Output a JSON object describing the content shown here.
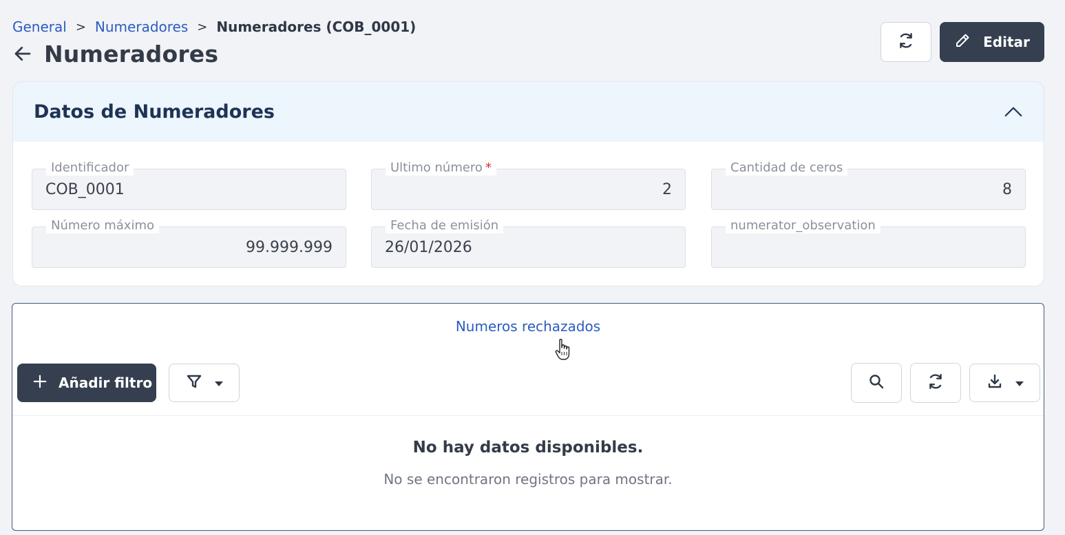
{
  "breadcrumb": {
    "items": [
      "General",
      "Numeradores"
    ],
    "separator": ">",
    "current": "Numeradores (COB_0001)"
  },
  "header": {
    "title": "Numeradores",
    "edit_label": "Editar"
  },
  "section": {
    "title": "Datos de Numeradores"
  },
  "fields": {
    "identificador": {
      "label": "Identificador",
      "value": "COB_0001"
    },
    "ultimo_numero": {
      "label": "Ultimo número",
      "required_mark": "*",
      "value": "2"
    },
    "cantidad_ceros": {
      "label": "Cantidad de ceros",
      "value": "8"
    },
    "numero_maximo": {
      "label": "Número máximo",
      "value": "99.999.999"
    },
    "fecha_emision": {
      "label": "Fecha de emisión",
      "value": "26/01/2026"
    },
    "observation": {
      "label": "numerator_observation",
      "value": ""
    }
  },
  "panel": {
    "tab_label": "Numeros rechazados",
    "add_filter_label": "Añadir filtro",
    "empty_title": "No hay datos disponibles.",
    "empty_subtitle": "No se encontraron registros para mostrar."
  },
  "icons": {
    "back": "arrow-left-icon",
    "refresh": "refresh-icon",
    "edit": "pencil-icon",
    "collapse": "chevron-up-icon",
    "add": "plus-icon",
    "filter": "funnel-icon",
    "search": "search-icon",
    "download": "download-icon",
    "cursor": "hand-pointer-icon"
  },
  "colors": {
    "link": "#2a5cbf",
    "primary_button": "#353f50",
    "section_header_bg": "#edf5fd",
    "required": "#d32f2f"
  }
}
